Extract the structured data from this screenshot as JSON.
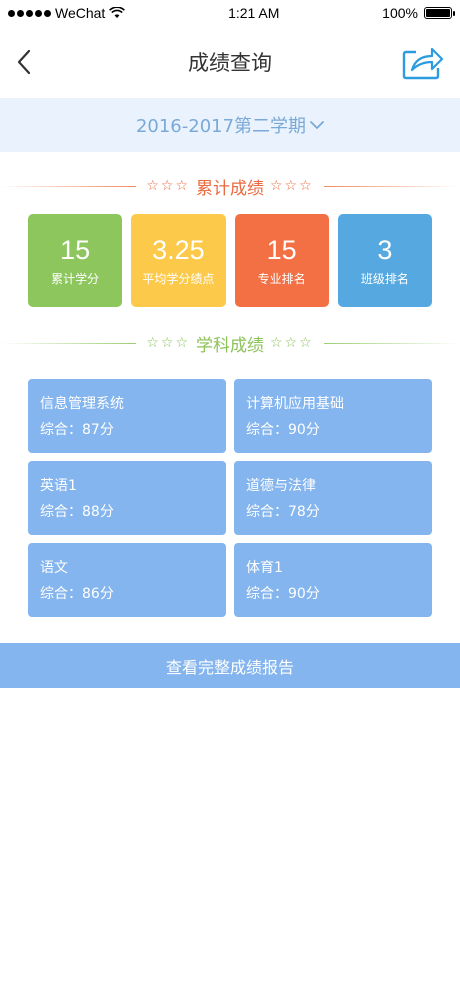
{
  "status_bar": {
    "carrier": "WeChat",
    "time": "1:21 AM",
    "battery": "100%"
  },
  "nav": {
    "title": "成绩查询"
  },
  "semester": {
    "label": "2016-2017第二学期"
  },
  "cumulative": {
    "title": "累计成绩",
    "stars_left": "☆☆☆",
    "stars_right": "☆☆☆",
    "stats": [
      {
        "value": "15",
        "label": "累计学分",
        "color": "#8cc65d"
      },
      {
        "value": "3.25",
        "label": "平均学分绩点",
        "color": "#fcc94a"
      },
      {
        "value": "15",
        "label": "专业排名",
        "color": "#f27043"
      },
      {
        "value": "3",
        "label": "班级排名",
        "color": "#56a9e0"
      }
    ]
  },
  "subjects_section": {
    "title": "学科成绩",
    "stars_left": "☆☆☆",
    "stars_right": "☆☆☆",
    "items": [
      {
        "name": "信息管理系统",
        "score": "综合：87分"
      },
      {
        "name": "计算机应用基础",
        "score": "综合：90分"
      },
      {
        "name": "英语1",
        "score": "综合：88分"
      },
      {
        "name": "道德与法律",
        "score": "综合：78分"
      },
      {
        "name": "语文",
        "score": "综合：86分"
      },
      {
        "name": "体育1",
        "score": "综合：90分"
      }
    ]
  },
  "report_button": {
    "label": "查看完整成绩报告"
  },
  "colors": {
    "accent_blue": "#84b5ee",
    "semester_bg": "#eaf3fd",
    "orange_title": "#e96a3f",
    "green_title": "#8cc25a"
  }
}
